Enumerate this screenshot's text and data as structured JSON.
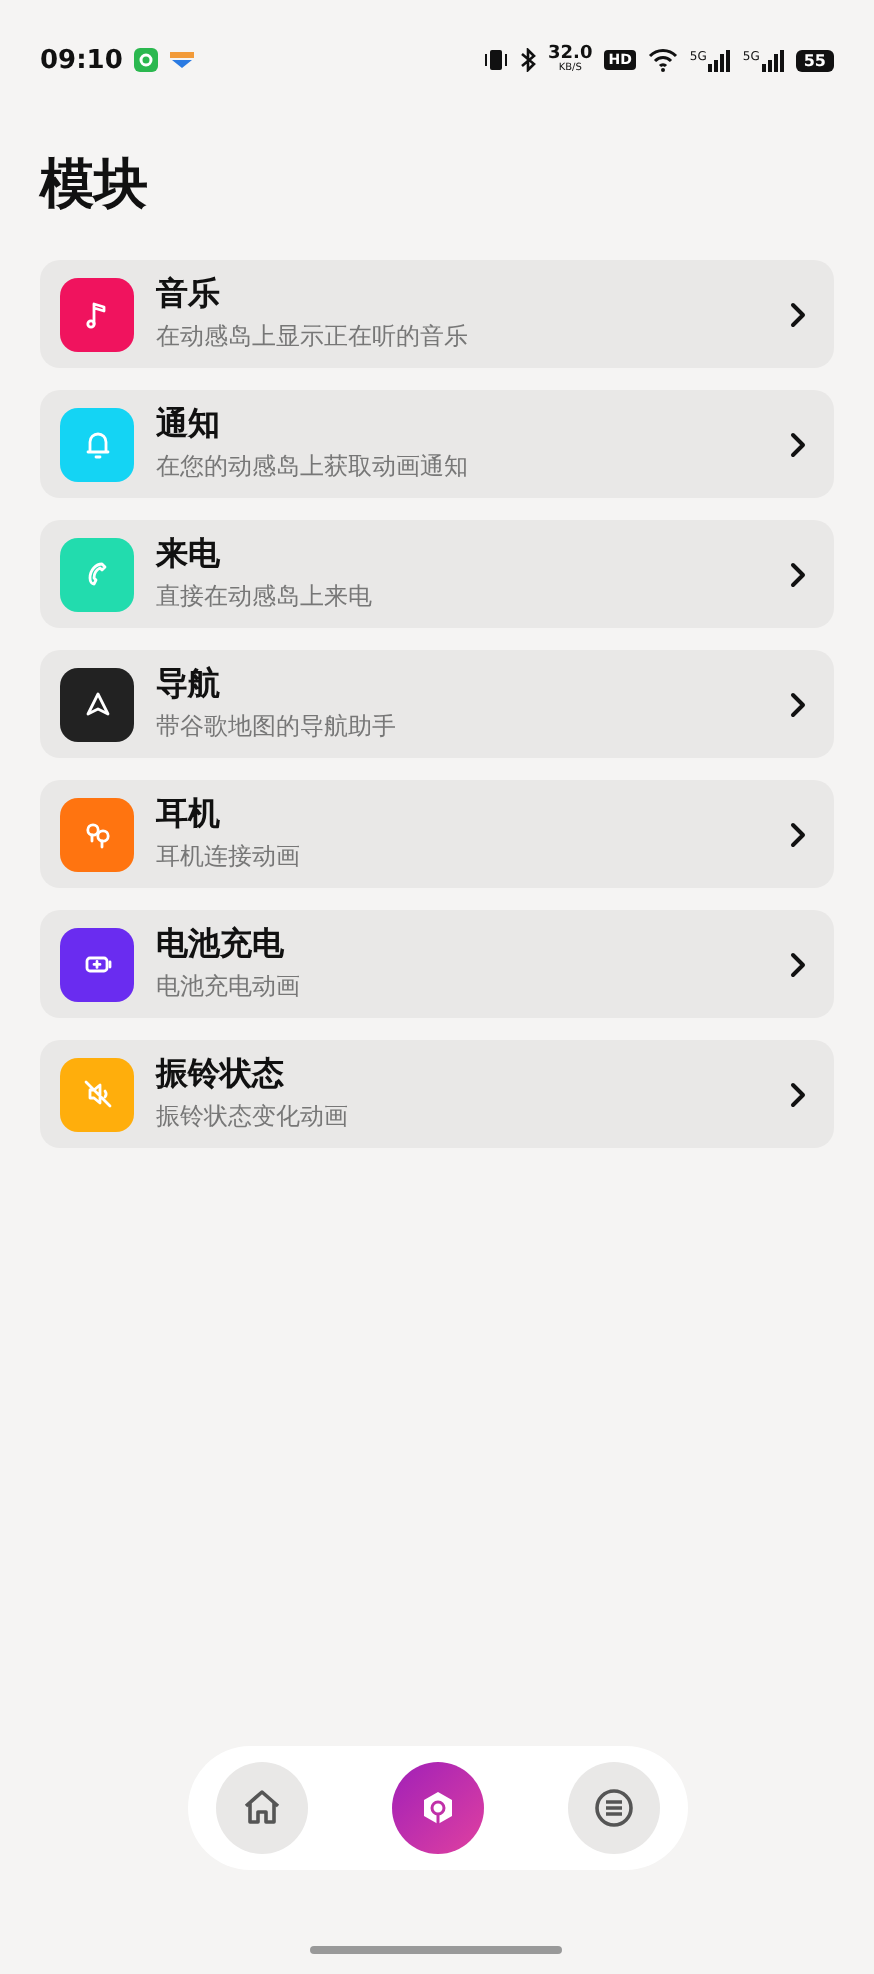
{
  "status_bar": {
    "time": "09:10",
    "speed": "32.0",
    "speed_unit": "KB/S",
    "hd": "HD",
    "signal_1": "5G",
    "signal_2": "5G",
    "battery": "55"
  },
  "title": "模块",
  "modules": [
    {
      "kind": "music",
      "color": "#f0135e",
      "title": "音乐",
      "subtitle": "在动感岛上显示正在听的音乐"
    },
    {
      "kind": "bell",
      "color": "#14d4f4",
      "title": "通知",
      "subtitle": "在您的动感岛上获取动画通知"
    },
    {
      "kind": "phone",
      "color": "#22dcae",
      "title": "来电",
      "subtitle": "直接在动感岛上来电"
    },
    {
      "kind": "navigation",
      "color": "#222222",
      "title": "导航",
      "subtitle": "带谷歌地图的导航助手"
    },
    {
      "kind": "earbuds",
      "color": "#ff7410",
      "title": "耳机",
      "subtitle": "耳机连接动画"
    },
    {
      "kind": "battery",
      "color": "#6a2cf0",
      "title": "电池充电",
      "subtitle": "电池充电动画"
    },
    {
      "kind": "mute",
      "color": "#ffae0c",
      "title": "振铃状态",
      "subtitle": "振铃状态变化动画"
    }
  ],
  "nav": [
    {
      "kind": "home",
      "selected": false
    },
    {
      "kind": "modules",
      "selected": true
    },
    {
      "kind": "menu",
      "selected": false
    }
  ]
}
